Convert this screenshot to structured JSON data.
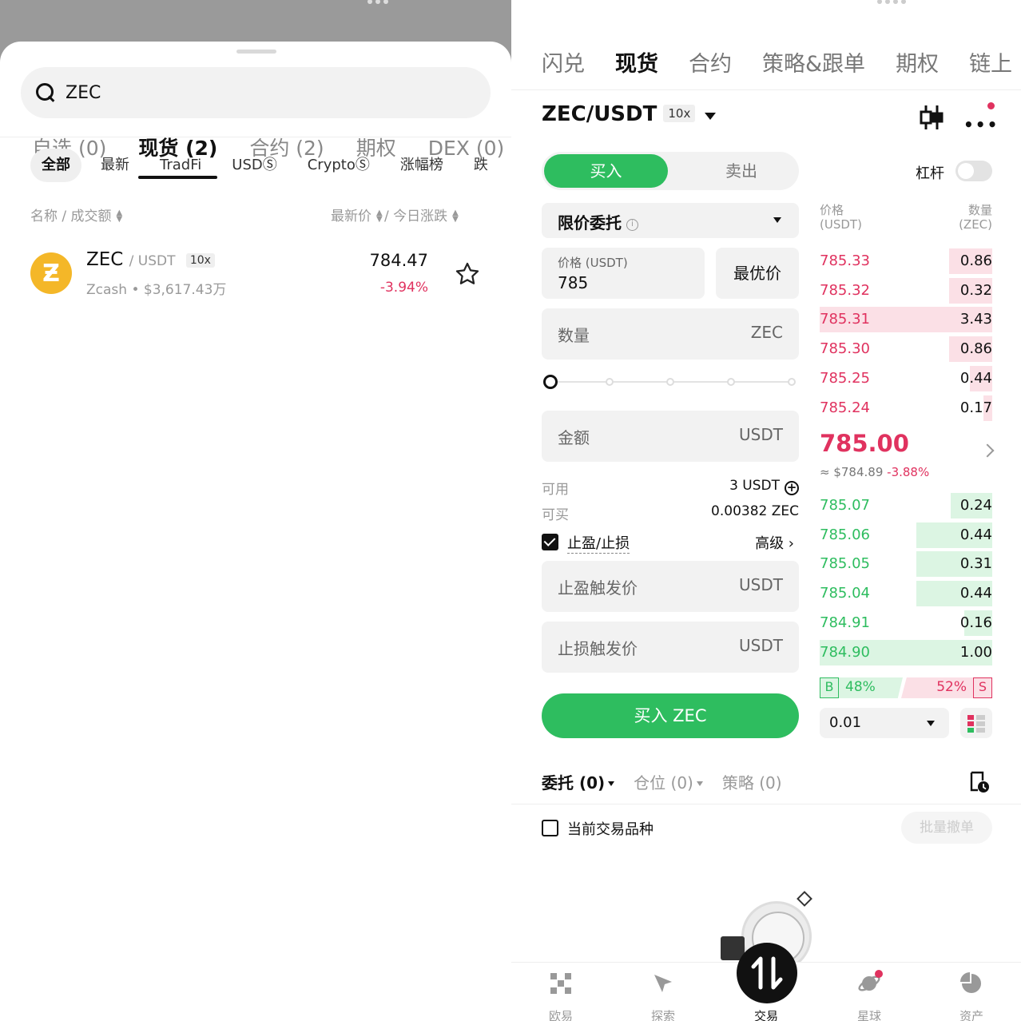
{
  "left": {
    "search": {
      "query": "ZEC"
    },
    "tabs": [
      {
        "label": "自选 (0)"
      },
      {
        "label": "现货 (2)"
      },
      {
        "label": "合约 (2)"
      },
      {
        "label": "期权"
      },
      {
        "label": "DEX (0)"
      }
    ],
    "chips": [
      {
        "label": "全部"
      },
      {
        "label": "最新"
      },
      {
        "label": "TradFi"
      },
      {
        "label": "USDⓈ"
      },
      {
        "label": "CryptoⓈ"
      },
      {
        "label": "涨幅榜"
      },
      {
        "label": "跌"
      }
    ],
    "columns": {
      "name": "名称 / 成交额",
      "price": "最新价",
      "change": "/ 今日涨跌"
    },
    "row": {
      "symbol": "ZEC",
      "pair": "/ USDT",
      "leverage": "10x",
      "name": "Zcash",
      "volume": "$3,617.43万",
      "sep": " • ",
      "price": "784.47",
      "change": "-3.94%",
      "logo_glyph": "Ƶ",
      "logo_color": "#f4b728"
    }
  },
  "right": {
    "nav": [
      {
        "label": "闪兑"
      },
      {
        "label": "现货"
      },
      {
        "label": "合约"
      },
      {
        "label": "策略&跟单"
      },
      {
        "label": "期权"
      },
      {
        "label": "链上"
      }
    ],
    "pair": "ZEC/USDT",
    "pair_leverage": "10x",
    "buy_tab": "买入",
    "sell_tab": "卖出",
    "leverage_label": "杠杆",
    "order_type": "限价委托",
    "price_label": "价格 (USDT)",
    "price_value": "785",
    "best_price": "最优价",
    "qty_label": "数量",
    "qty_unit": "ZEC",
    "amount_label": "金额",
    "amount_unit": "USDT",
    "available_label": "可用",
    "available_value": "3 USDT",
    "canbuy_label": "可买",
    "canbuy_value": "0.00382 ZEC",
    "tpsl_label": "止盈/止损",
    "advanced": "高级 ›",
    "tp_label": "止盈触发价",
    "tp_unit": "USDT",
    "sl_label": "止损触发价",
    "sl_unit": "USDT",
    "buy_button": "买入 ZEC",
    "orderbook": {
      "price_head": "价格",
      "price_unit": "(USDT)",
      "qty_head": "数量",
      "qty_unit": "(ZEC)",
      "asks": [
        {
          "price": "785.33",
          "qty": "0.86",
          "depth": 0.25
        },
        {
          "price": "785.32",
          "qty": "0.32",
          "depth": 0.25
        },
        {
          "price": "785.31",
          "qty": "3.43",
          "depth": 1.0
        },
        {
          "price": "785.30",
          "qty": "0.86",
          "depth": 0.25
        },
        {
          "price": "785.25",
          "qty": "0.44",
          "depth": 0.13
        },
        {
          "price": "785.24",
          "qty": "0.17",
          "depth": 0.05
        }
      ],
      "last_price": "785.00",
      "last_usd": "≈ $784.89",
      "last_change": "-3.88%",
      "bids": [
        {
          "price": "785.07",
          "qty": "0.24",
          "depth": 0.24
        },
        {
          "price": "785.06",
          "qty": "0.44",
          "depth": 0.44
        },
        {
          "price": "785.05",
          "qty": "0.31",
          "depth": 0.44
        },
        {
          "price": "785.04",
          "qty": "0.44",
          "depth": 0.44
        },
        {
          "price": "784.91",
          "qty": "0.16",
          "depth": 0.16
        },
        {
          "price": "784.90",
          "qty": "1.00",
          "depth": 1.0
        }
      ],
      "buy_ratio": "48%",
      "sell_ratio": "52%",
      "b_label": "B",
      "s_label": "S",
      "depth_step": "0.01"
    },
    "bottom_tabs": [
      {
        "label": "委托 (0)"
      },
      {
        "label": "仓位 (0)"
      },
      {
        "label": "策略 (0)"
      }
    ],
    "current_pair_only": "当前交易品种",
    "cancel_all": "批量撤单",
    "tabbar": [
      {
        "label": "欧易"
      },
      {
        "label": "探索"
      },
      {
        "label": "交易"
      },
      {
        "label": "星球"
      },
      {
        "label": "资产"
      }
    ],
    "colors": {
      "buy_green": "#2ebd5f",
      "sell_red": "#e0325f"
    }
  }
}
